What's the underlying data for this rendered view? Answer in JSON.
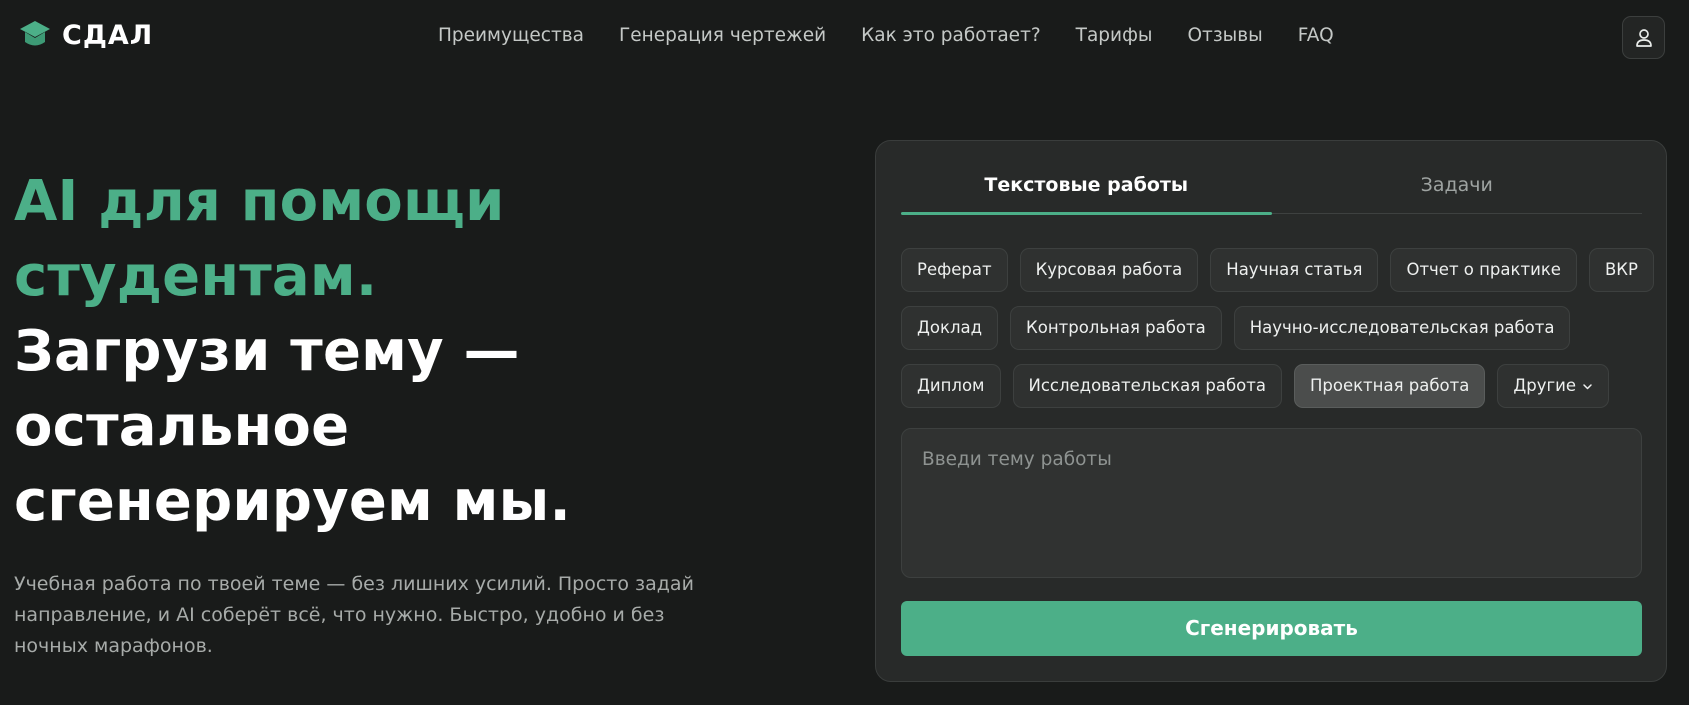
{
  "brand": {
    "name": "СДАЛ",
    "accent_color": "#4caf88"
  },
  "nav": {
    "items": [
      "Преимущества",
      "Генерация чертежей",
      "Как это работает?",
      "Тарифы",
      "Отзывы",
      "FAQ"
    ]
  },
  "user_icon": "user-icon",
  "hero": {
    "accent_line_1": "AI для помощи",
    "accent_line_2": "студентам.",
    "main_line_1": "Загрузи тему —",
    "main_line_2": "остальное",
    "main_line_3": "сгенерируем мы.",
    "description": "Учебная работа по твоей теме — без лишних усилий. Просто задай направление, и AI соберёт всё, что нужно. Быстро, удобно и без ночных марафонов."
  },
  "form": {
    "tabs": [
      "Текстовые работы",
      "Задачи"
    ],
    "active_tab": "Текстовые работы",
    "chips": [
      [
        "Реферат",
        "Курсовая работа",
        "Научная статья",
        "Отчет о практике",
        "ВКР"
      ],
      [
        "Доклад",
        "Контрольная работа",
        "Научно-исследовательская работа"
      ],
      [
        "Диплом",
        "Исследовательская работа",
        "Проектная работа",
        "Другие"
      ]
    ],
    "selected_chip": "Проектная работа",
    "topic_placeholder": "Введи тему работы",
    "generate_label": "Сгенерировать"
  }
}
